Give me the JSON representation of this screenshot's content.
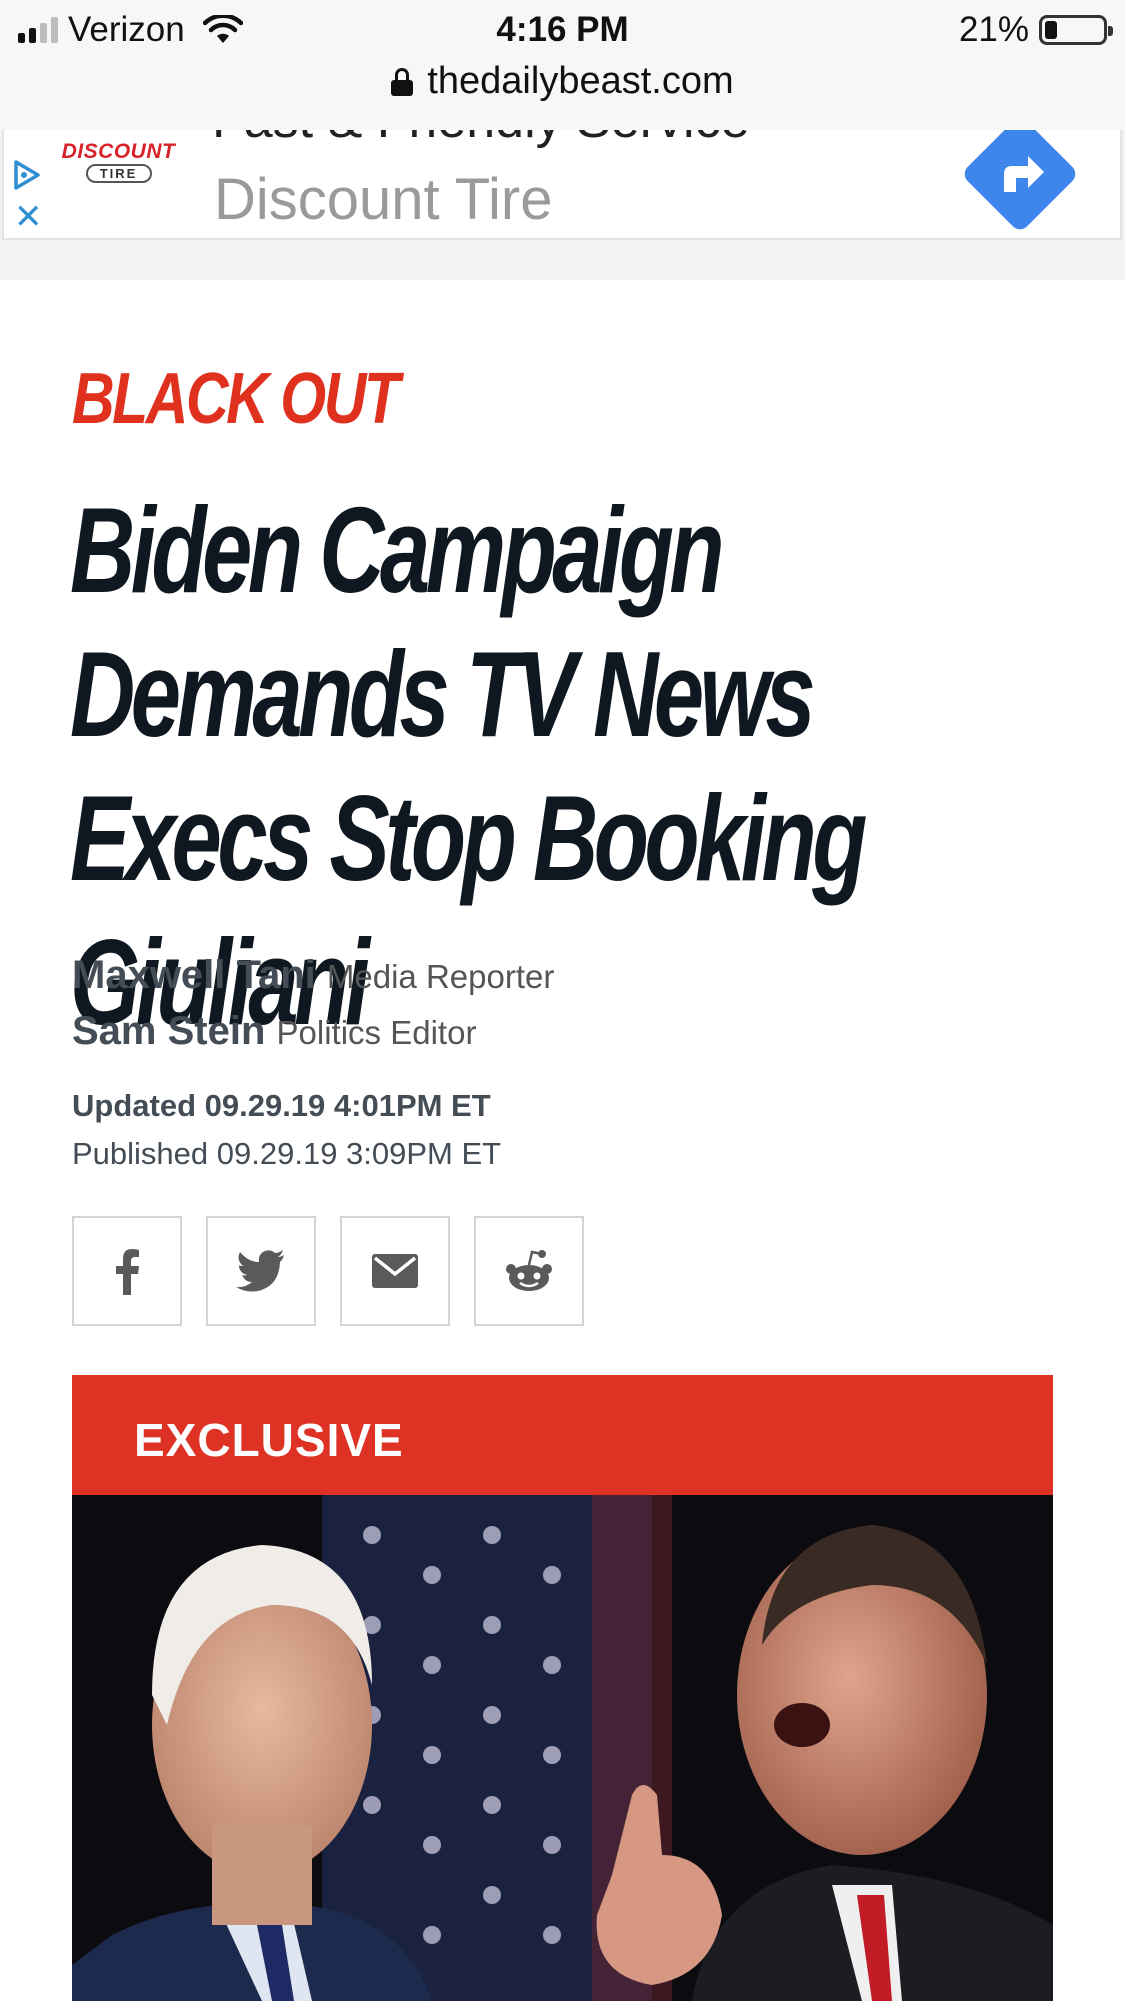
{
  "status_bar": {
    "carrier": "Verizon",
    "time": "4:16 PM",
    "battery": "21%",
    "battery_level": 0.21
  },
  "address_bar": {
    "url": "thedailybeast.com"
  },
  "ad": {
    "brand_logo_line1": "DISCOUNT",
    "brand_logo_line2": "TIRE",
    "tagline": "Fast & Friendly Service",
    "advertiser": "Discount Tire"
  },
  "article": {
    "kicker": "BLACK OUT",
    "headline": "Biden Campaign Demands TV News Execs Stop Booking Giuliani",
    "authors": [
      {
        "name": "Maxwell Tani",
        "role": "Media Reporter"
      },
      {
        "name": "Sam Stein",
        "role": "Politics Editor"
      }
    ],
    "updated": "Updated 09.29.19 4:01PM ET",
    "published": "Published 09.29.19 3:09PM ET",
    "share_icons": [
      "facebook-icon",
      "twitter-icon",
      "email-icon",
      "reddit-icon"
    ],
    "badge": "EXCLUSIVE"
  },
  "colors": {
    "accent_red": "#e0301e",
    "badge_red": "#dd3224",
    "headline": "#0f1821",
    "ad_button": "#3f86ec"
  }
}
